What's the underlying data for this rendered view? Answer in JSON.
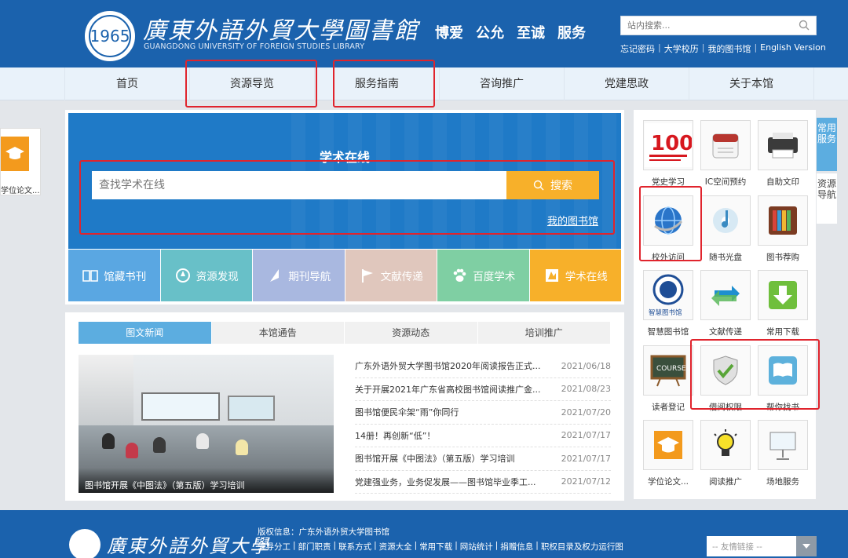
{
  "header": {
    "logo_cn": "廣東外語外貿大學圖書館",
    "logo_en": "GUANGDONG UNIVERSITY OF FOREIGN STUDIES LIBRARY",
    "seal_text": "1965",
    "motto": [
      "博爱",
      "公允",
      "至诚",
      "服务"
    ],
    "search_placeholder": "站内搜索...",
    "top_links": [
      "忘记密码",
      "大学校历",
      "我的图书馆",
      "English Version"
    ]
  },
  "nav": [
    "首页",
    "资源导览",
    "服务指南",
    "咨询推广",
    "党建思政",
    "关于本馆"
  ],
  "left_float_label": "学位论文...",
  "search_panel": {
    "title": "学术在线",
    "placeholder": "查找学术在线",
    "button": "搜索",
    "my_library": "我的图书馆"
  },
  "quick_links": [
    {
      "label": "馆藏书刊",
      "color": "#5aa7e2",
      "icon": "book-icon"
    },
    {
      "label": "资源发现",
      "color": "#68c0c8",
      "icon": "compass-icon"
    },
    {
      "label": "期刊导航",
      "color": "#a9b8e0",
      "icon": "navigate-icon"
    },
    {
      "label": "文献传递",
      "color": "#e0c7bd",
      "icon": "flag-icon"
    },
    {
      "label": "百度学术",
      "color": "#7fcfa3",
      "icon": "paw-icon"
    },
    {
      "label": "学术在线",
      "color": "#f7b02a",
      "icon": "scholar-icon"
    }
  ],
  "news": {
    "tabs": [
      "图文新闻",
      "本馆通告",
      "资源动态",
      "培训推广"
    ],
    "photo_caption": "图书馆开展《中图法》（第五版）学习培训",
    "items": [
      {
        "title": "广东外语外贸大学图书馆2020年阅读报告正式...",
        "date": "2021/06/18"
      },
      {
        "title": "关于开展2021年广东省高校图书馆阅读推广金...",
        "date": "2021/08/23"
      },
      {
        "title": "图书馆便民伞架“雨”你同行",
        "date": "2021/07/20"
      },
      {
        "title": "14册！再创新“低”！",
        "date": "2021/07/17"
      },
      {
        "title": "图书馆开展《中图法》（第五版）学习培训",
        "date": "2021/07/17"
      },
      {
        "title": "党建强业务，业务促发展——图书馆毕业季工...",
        "date": "2021/07/12"
      }
    ]
  },
  "services": [
    {
      "label": "党史学习",
      "icon": "party-history-icon",
      "badge": "100"
    },
    {
      "label": "IC空间预约",
      "icon": "calendar-icon"
    },
    {
      "label": "自助文印",
      "icon": "printer-icon"
    },
    {
      "label": "校外访问",
      "icon": "globe-icon"
    },
    {
      "label": "随书光盘",
      "icon": "music-disc-icon"
    },
    {
      "label": "图书荐购",
      "icon": "bookshelf-icon"
    },
    {
      "label": "智慧图书馆",
      "icon": "smart-library-icon",
      "badge": "智慧图书馆"
    },
    {
      "label": "文献传递",
      "icon": "exchange-arrows-icon"
    },
    {
      "label": "常用下载",
      "icon": "download-icon"
    },
    {
      "label": "读者登记",
      "icon": "blackboard-icon",
      "badge": "COURSE"
    },
    {
      "label": "借阅权限",
      "icon": "shield-check-icon"
    },
    {
      "label": "帮你找书",
      "icon": "open-book-icon"
    },
    {
      "label": "学位论文...",
      "icon": "graduation-cap-icon"
    },
    {
      "label": "阅读推广",
      "icon": "lightbulb-icon"
    },
    {
      "label": "场地服务",
      "icon": "projector-screen-icon"
    }
  ],
  "side_tabs": [
    "常用服务",
    "资源导航"
  ],
  "footer": {
    "name": "廣東外語外貿大學",
    "copyright": "版权信息：广东外语外贸大学图书馆",
    "links": [
      "领导分工",
      "部门职责",
      "联系方式",
      "资源大全",
      "常用下载",
      "网站统计",
      "捐赠信息",
      "职权目录及权力运行图"
    ],
    "friend_links_placeholder": "-- 友情链接 --"
  },
  "colors": {
    "header": "#1b62ad",
    "accent": "#f7b02a",
    "highlight": "#e0242d",
    "tab_active": "#5cade0"
  }
}
